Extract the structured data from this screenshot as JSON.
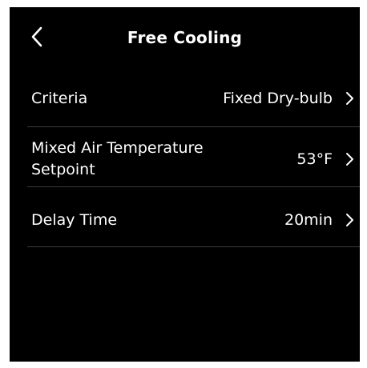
{
  "header": {
    "title": "Free Cooling",
    "back_icon": "chevron-left-icon"
  },
  "settings": [
    {
      "label": "Criteria",
      "value": "Fixed Dry-bulb",
      "icon": "chevron-right-icon"
    },
    {
      "label_line1": "Mixed Air Temperature",
      "label_line2": "Setpoint",
      "value": "53°F",
      "icon": "chevron-right-icon"
    },
    {
      "label": "Delay Time",
      "value": "20min",
      "icon": "chevron-right-icon"
    }
  ],
  "colors": {
    "background": "#000000",
    "text": "#ffffff",
    "divider": "#3a3a3a"
  }
}
